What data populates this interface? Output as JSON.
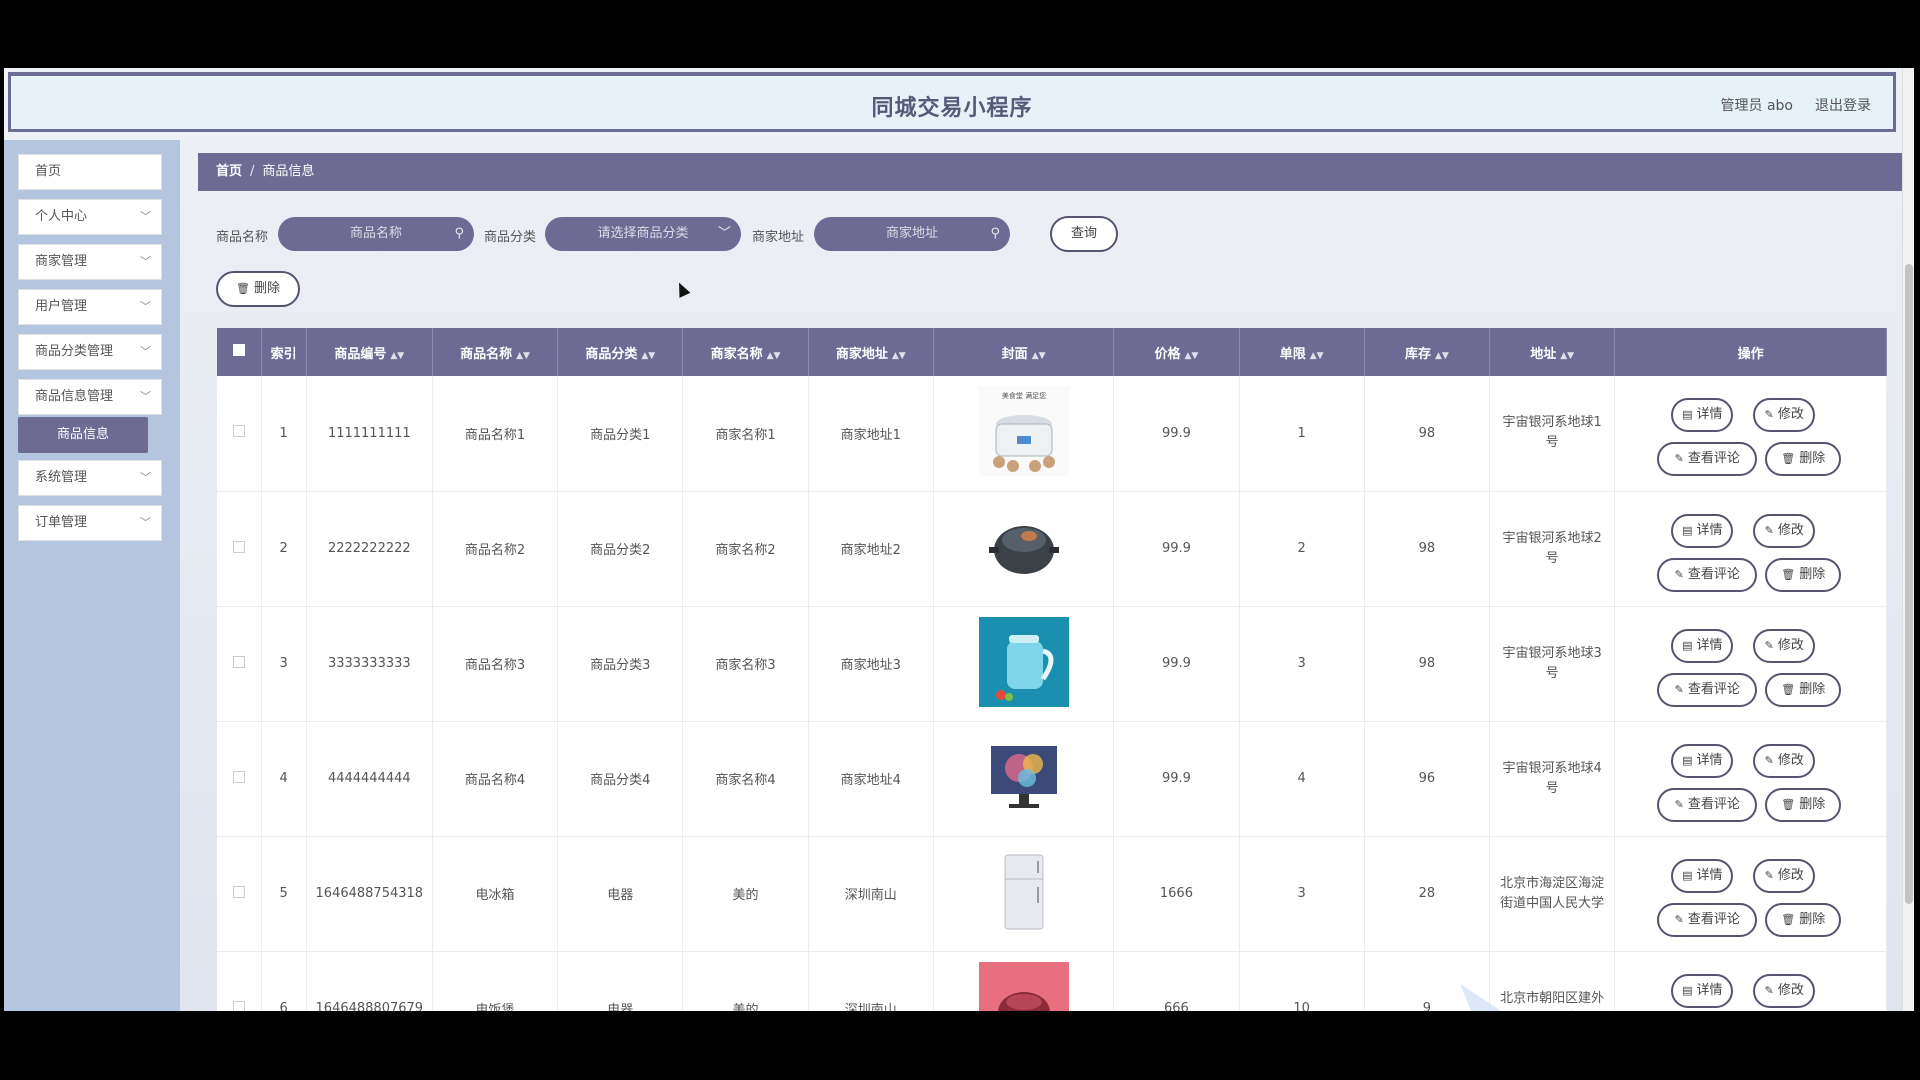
{
  "header": {
    "title": "同城交易小程序",
    "admin": "管理员 abo",
    "logout": "退出登录"
  },
  "sidebar": {
    "items": [
      {
        "label": "首页",
        "chevron": false
      },
      {
        "label": "个人中心",
        "chevron": true
      },
      {
        "label": "商家管理",
        "chevron": true
      },
      {
        "label": "用户管理",
        "chevron": true
      },
      {
        "label": "商品分类管理",
        "chevron": true
      },
      {
        "label": "商品信息管理",
        "chevron": true
      },
      {
        "label": "系统管理",
        "chevron": true
      },
      {
        "label": "订单管理",
        "chevron": true
      }
    ],
    "active_sub": "商品信息"
  },
  "breadcrumb": {
    "home": "首页",
    "current": "商品信息"
  },
  "search": {
    "name_label": "商品名称",
    "name_placeholder": "商品名称",
    "category_label": "商品分类",
    "category_placeholder": "请选择商品分类",
    "address_label": "商家地址",
    "address_placeholder": "商家地址",
    "query_button": "查询",
    "delete_button": "删除"
  },
  "table": {
    "headers": [
      "索引",
      "商品编号",
      "商品名称",
      "商品分类",
      "商家名称",
      "商家地址",
      "封面",
      "价格",
      "单限",
      "库存",
      "地址",
      "操作"
    ],
    "actions": {
      "detail": "详情",
      "edit": "修改",
      "comments": "查看评论",
      "delete": "删除"
    },
    "rows": [
      {
        "index": "1",
        "code": "1111111111",
        "name": "商品名称1",
        "category": "商品分类1",
        "merchant": "商家名称1",
        "merchant_addr": "商家地址1",
        "cover": "rice-cooker",
        "price": "99.9",
        "limit": "1",
        "stock": "98",
        "address": "宇宙银河系地球1号"
      },
      {
        "index": "2",
        "code": "2222222222",
        "name": "商品名称2",
        "category": "商品分类2",
        "merchant": "商家名称2",
        "merchant_addr": "商家地址2",
        "cover": "pressure-pot",
        "price": "99.9",
        "limit": "2",
        "stock": "98",
        "address": "宇宙银河系地球2号"
      },
      {
        "index": "3",
        "code": "3333333333",
        "name": "商品名称3",
        "category": "商品分类3",
        "merchant": "商家名称3",
        "merchant_addr": "商家地址3",
        "cover": "kettle",
        "price": "99.9",
        "limit": "3",
        "stock": "98",
        "address": "宇宙银河系地球3号"
      },
      {
        "index": "4",
        "code": "4444444444",
        "name": "商品名称4",
        "category": "商品分类4",
        "merchant": "商家名称4",
        "merchant_addr": "商家地址4",
        "cover": "monitor",
        "price": "99.9",
        "limit": "4",
        "stock": "96",
        "address": "宇宙银河系地球4号"
      },
      {
        "index": "5",
        "code": "1646488754318",
        "name": "电冰箱",
        "category": "电器",
        "merchant": "美的",
        "merchant_addr": "深圳南山",
        "cover": "fridge",
        "price": "1666",
        "limit": "3",
        "stock": "28",
        "address": "北京市海淀区海淀街道中国人民大学"
      },
      {
        "index": "6",
        "code": "1646488807679",
        "name": "电饭煲",
        "category": "电器",
        "merchant": "美的",
        "merchant_addr": "深圳南山",
        "cover": "red-cooker",
        "price": "666",
        "limit": "10",
        "stock": "9",
        "address": "北京市朝阳区建外街道阜通东大街北"
      }
    ]
  },
  "colors": {
    "accent": "#6d6b94",
    "sidebar_bg": "#b4c6df",
    "header_bg": "#e6f1f8"
  }
}
